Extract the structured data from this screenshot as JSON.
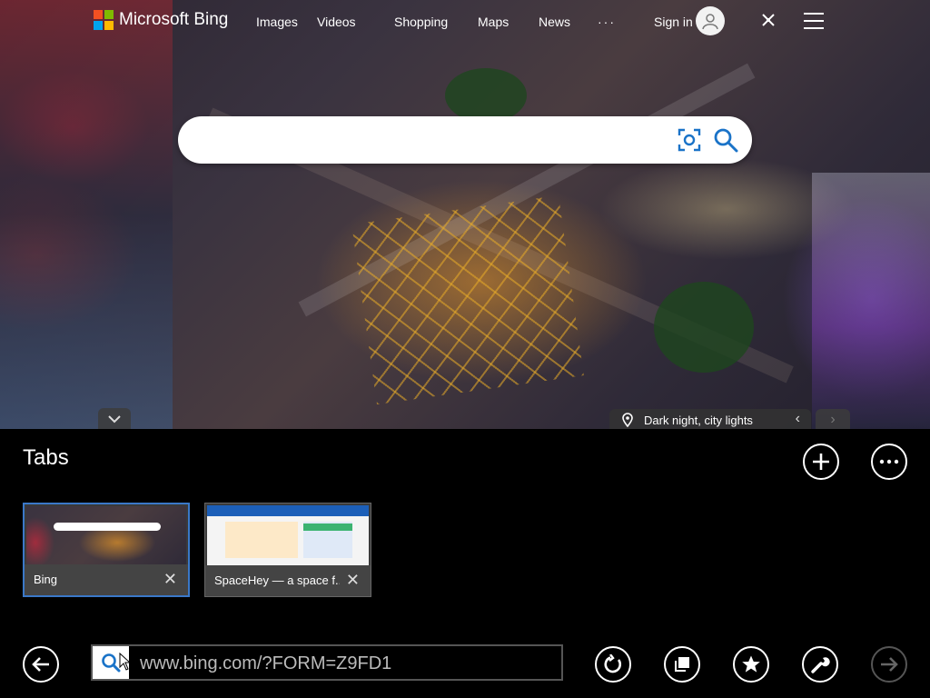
{
  "bing": {
    "logo_text": "Microsoft Bing",
    "nav": [
      "Images",
      "Videos",
      "Shopping",
      "Maps",
      "News"
    ],
    "more": "···",
    "sign_in": "Sign in",
    "search_placeholder": "",
    "image_info": "Dark night, city lights"
  },
  "tabs_panel": {
    "title": "Tabs",
    "tabs": [
      {
        "title": "Bing",
        "active": true
      },
      {
        "title": "SpaceHey — a space f...",
        "active": false
      }
    ]
  },
  "address_bar": {
    "url": "www.bing.com/?FORM=Z9FD1"
  },
  "colors": {
    "active_tab_border": "#3a78c8",
    "background": "#000000",
    "ms_red": "#f25022",
    "ms_green": "#7fba00",
    "ms_blue": "#00a4ef",
    "ms_yellow": "#ffb900",
    "search_icon_blue": "#1a73c8"
  },
  "icons": {
    "new_tab": "plus-icon",
    "tab_menu": "more-icon",
    "back": "back-arrow-icon",
    "refresh": "refresh-icon",
    "tabs": "tabs-icon",
    "favorites": "star-icon",
    "tools": "wrench-icon",
    "forward": "forward-arrow-icon"
  }
}
